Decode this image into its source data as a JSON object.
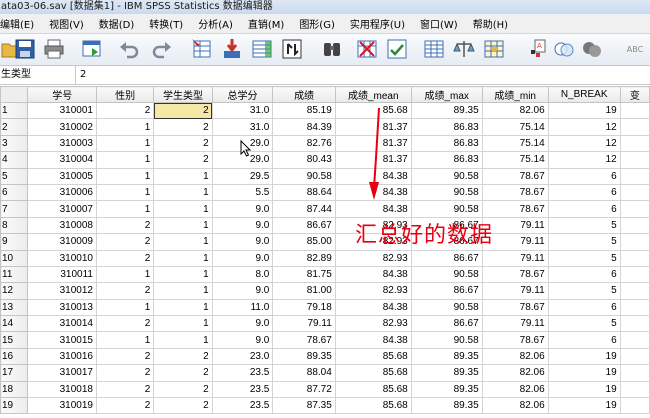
{
  "window": {
    "title": "ata03-06.sav [数据集1] - IBM SPSS Statistics 数据编辑器"
  },
  "menu": [
    "编辑(E)",
    "视图(V)",
    "数据(D)",
    "转换(T)",
    "分析(A)",
    "直销(M)",
    "图形(G)",
    "实用程序(U)",
    "窗口(W)",
    "帮助(H)"
  ],
  "toolbar": {
    "icons": [
      "open-folder-icon",
      "save-icon",
      "print-icon",
      "dialog-recall-icon",
      "undo-icon",
      "redo-icon",
      "goto-case-icon",
      "goto-variable-icon",
      "variables-icon",
      "insert-case-icon",
      "find-icon",
      "insert-variable-icon",
      "split-file-icon",
      "weight-cases-icon",
      "select-cases-icon",
      "value-labels-icon",
      "use-sets-icon",
      "show-all-icon",
      "spell-icon"
    ],
    "spell_label": "ABC"
  },
  "cell_editor": {
    "ref": "生类型",
    "value": "2"
  },
  "grid": {
    "columns": [
      "学号",
      "性别",
      "学生类型",
      "总学分",
      "成绩",
      "成绩_mean",
      "成绩_max",
      "成绩_min",
      "N_BREAK",
      "变"
    ],
    "rows": [
      [
        "1",
        "310001",
        "2",
        "2",
        "31.0",
        "85.19",
        "85.68",
        "89.35",
        "82.06",
        "19"
      ],
      [
        "2",
        "310002",
        "1",
        "2",
        "31.0",
        "84.39",
        "81.37",
        "86.83",
        "75.14",
        "12"
      ],
      [
        "3",
        "310003",
        "1",
        "2",
        "29.0",
        "82.76",
        "81.37",
        "86.83",
        "75.14",
        "12"
      ],
      [
        "4",
        "310004",
        "1",
        "2",
        "29.0",
        "80.43",
        "81.37",
        "86.83",
        "75.14",
        "12"
      ],
      [
        "5",
        "310005",
        "1",
        "1",
        "29.5",
        "90.58",
        "84.38",
        "90.58",
        "78.67",
        "6"
      ],
      [
        "6",
        "310006",
        "1",
        "1",
        "5.5",
        "88.64",
        "84.38",
        "90.58",
        "78.67",
        "6"
      ],
      [
        "7",
        "310007",
        "1",
        "1",
        "9.0",
        "87.44",
        "84.38",
        "90.58",
        "78.67",
        "6"
      ],
      [
        "8",
        "310008",
        "2",
        "1",
        "9.0",
        "86.67",
        "82.93",
        "86.67",
        "79.11",
        "5"
      ],
      [
        "9",
        "310009",
        "2",
        "1",
        "9.0",
        "85.00",
        "82.93",
        "86.67",
        "79.11",
        "5"
      ],
      [
        "10",
        "310010",
        "2",
        "1",
        "9.0",
        "82.89",
        "82.93",
        "86.67",
        "79.11",
        "5"
      ],
      [
        "11",
        "310011",
        "1",
        "1",
        "8.0",
        "81.75",
        "84.38",
        "90.58",
        "78.67",
        "6"
      ],
      [
        "12",
        "310012",
        "2",
        "1",
        "9.0",
        "81.00",
        "82.93",
        "86.67",
        "79.11",
        "5"
      ],
      [
        "13",
        "310013",
        "1",
        "1",
        "11.0",
        "79.18",
        "84.38",
        "90.58",
        "78.67",
        "6"
      ],
      [
        "14",
        "310014",
        "2",
        "1",
        "9.0",
        "79.11",
        "82.93",
        "86.67",
        "79.11",
        "5"
      ],
      [
        "15",
        "310015",
        "1",
        "1",
        "9.0",
        "78.67",
        "84.38",
        "90.58",
        "78.67",
        "6"
      ],
      [
        "16",
        "310016",
        "2",
        "2",
        "23.0",
        "89.35",
        "85.68",
        "89.35",
        "82.06",
        "19"
      ],
      [
        "17",
        "310017",
        "2",
        "2",
        "23.5",
        "88.04",
        "85.68",
        "89.35",
        "82.06",
        "19"
      ],
      [
        "18",
        "310018",
        "2",
        "2",
        "23.5",
        "87.72",
        "85.68",
        "89.35",
        "82.06",
        "19"
      ],
      [
        "19",
        "310019",
        "2",
        "2",
        "23.5",
        "87.35",
        "85.68",
        "89.35",
        "82.06",
        "19"
      ]
    ],
    "selected_value": "2"
  },
  "annotation": {
    "text": "汇总好的数据",
    "color": "#e60012"
  },
  "colors": {
    "selected_cell": "#f5e7a6",
    "header_bg": "#e9e9e9"
  }
}
